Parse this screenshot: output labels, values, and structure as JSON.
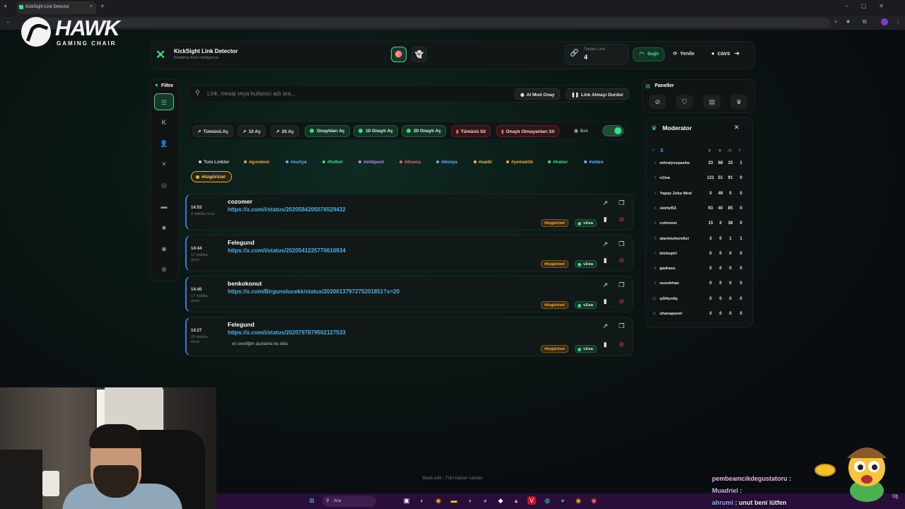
{
  "browser": {
    "tab_title": "KickSight Link Detector",
    "address_fragment": "/cavs",
    "tab_close": "×",
    "tab_new": "+"
  },
  "watermark": {
    "brand": "HAWK",
    "tagline": "GAMING CHAIR"
  },
  "header": {
    "app_title": "KickSight Link Detector",
    "app_subtitle": "Realtime Kick Intelligence",
    "total_label": "Toplam Link",
    "total_value": "4",
    "connection_label": "Bağlı",
    "refresh_label": "Yenile",
    "user_label": "cavs"
  },
  "sidebar": {
    "title": "Filtre",
    "icons": [
      "list-icon",
      "kick-icon",
      "user-icon",
      "x-icon",
      "instagram-icon",
      "youtube-icon",
      "video-icon",
      "camera-icon",
      "globe-icon"
    ]
  },
  "search": {
    "placeholder": "Link, mesaj veya kullanıcı adı ara...",
    "ai_mod_label": "AI Mod Onay",
    "stop_label": "Link Almayı Durdur"
  },
  "actions": {
    "open_all": "Tümünü Aç",
    "open_10": "10 Aç",
    "open_20": "20 Aç",
    "open_approved": "Onaylıları Aç",
    "open_10_approved": "10 Onaylı Aç",
    "open_20_approved": "20 Onaylı Aç",
    "delete_all": "Tümünü Sil",
    "delete_unapproved": "Onaylı Olmayanları Sil",
    "bot_label": "Bot"
  },
  "tags": [
    {
      "label": "Tum Linkler",
      "color": "#c8ccd0"
    },
    {
      "label": "#gundem",
      "color": "#f0a842"
    },
    {
      "label": "#suriye",
      "color": "#6ab0ff"
    },
    {
      "label": "#futbol",
      "color": "#3ddc84"
    },
    {
      "label": "#shitpost",
      "color": "#c086ff"
    },
    {
      "label": "#drama",
      "color": "#e26a6a"
    },
    {
      "label": "#dunya",
      "color": "#6ab0ff"
    },
    {
      "label": "#sarki",
      "color": "#f2c04a"
    },
    {
      "label": "#yemeklik",
      "color": "#f0a842"
    },
    {
      "label": "#haber",
      "color": "#3ddc84"
    },
    {
      "label": "#video",
      "color": "#6ab0ff"
    }
  ],
  "active_tag": "#özgürözel",
  "links": [
    {
      "time": "14:53",
      "ago": "3 dakika önce",
      "user": "cozomer",
      "url": "https://x.com/i/status/2020584205076529432",
      "note": "",
      "tag": "#özgürözel",
      "approver": "v1isa"
    },
    {
      "time": "14:44",
      "ago": "12 dakika önce",
      "user": "Felegund",
      "url": "https://x.com/i/status/2020541225770610934",
      "note": "",
      "tag": "#özgürözel",
      "approver": "v1isa"
    },
    {
      "time": "14:40",
      "ago": "17 dakika önce",
      "user": "benkokonut",
      "url": "https://x.com/Birgunolucekk/status/2020613797275201851?s=20",
      "note": "",
      "tag": "#özgürözel",
      "approver": "v1isa"
    },
    {
      "time": "14:27",
      "ago": "29 dakika önce",
      "user": "Felegund",
      "url": "https://x.com/i/status/2020797879502127533",
      "note": "en sevdiğim açıklama bu oldu",
      "tag": "#özgürözel",
      "approver": "v1isa"
    }
  ],
  "panels": {
    "title": "Paneller"
  },
  "moderator": {
    "title": "Moderator",
    "header_num": "#",
    "rows": [
      {
        "rank": "1",
        "name": "mitralyozpasha",
        "c1": "33",
        "c2": "88",
        "c3": "15",
        "c4": "1"
      },
      {
        "rank": "2",
        "name": "v1isa",
        "c1": "121",
        "c2": "51",
        "c3": "91",
        "c4": "0"
      },
      {
        "rank": "3",
        "name": "Yapay Zeka Mod",
        "c1": "0",
        "c2": "48",
        "c3": "0",
        "c4": "0"
      },
      {
        "rank": "4",
        "name": "skirtel53",
        "c1": "93",
        "c2": "40",
        "c3": "85",
        "c4": "0"
      },
      {
        "rank": "5",
        "name": "cotmoon",
        "c1": "15",
        "c2": "2",
        "c3": "38",
        "c4": "0"
      },
      {
        "rank": "6",
        "name": "atarimuhendisi",
        "c1": "3",
        "c2": "0",
        "c3": "1",
        "c4": "1"
      },
      {
        "rank": "7",
        "name": "bishopiri",
        "c1": "0",
        "c2": "0",
        "c3": "0",
        "c4": "0"
      },
      {
        "rank": "8",
        "name": "gadrass",
        "c1": "0",
        "c2": "0",
        "c3": "0",
        "c4": "0"
      },
      {
        "rank": "9",
        "name": "nusokhan",
        "c1": "0",
        "c2": "0",
        "c3": "0",
        "c4": "0"
      },
      {
        "rank": "10",
        "name": "q3l4yn4q",
        "c1": "0",
        "c2": "0",
        "c3": "0",
        "c4": "0"
      },
      {
        "rank": "11",
        "name": "shanapanel",
        "c1": "0",
        "c2": "0",
        "c3": "0",
        "c4": "0"
      }
    ]
  },
  "footer": {
    "text": "Made with  ·  Tüm hakları saklıdır"
  },
  "taskbar": {
    "search_label": "Ara",
    "clock_fragment": "Öğ"
  },
  "chat": [
    {
      "name": "pembeamcikdegustatoru",
      "sep": " :",
      "msg": ""
    },
    {
      "name": "Muadriel",
      "sep": " :",
      "msg": ""
    },
    {
      "name": "ahrumi",
      "sep": " :",
      "msg": " unut beni lütfen"
    }
  ]
}
